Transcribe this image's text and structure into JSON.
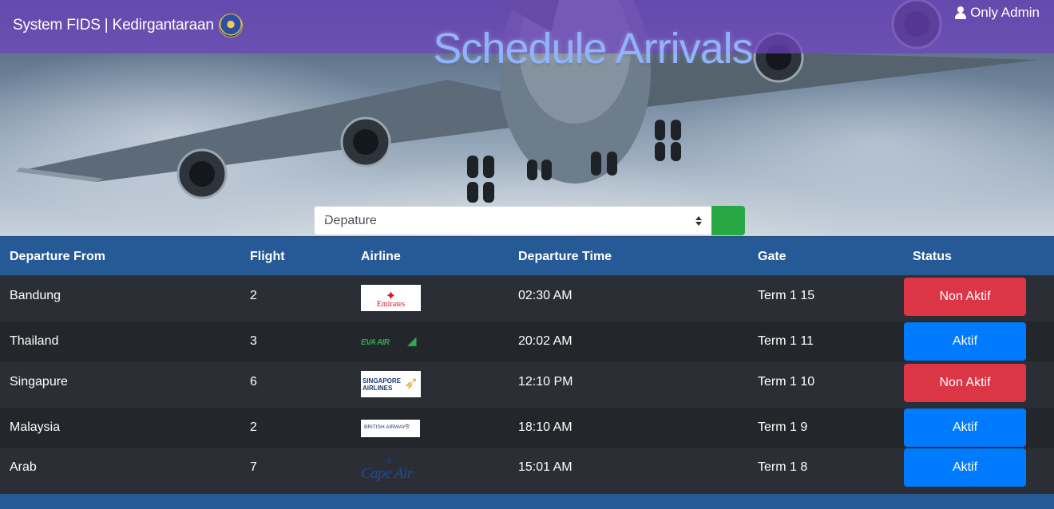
{
  "navbar": {
    "brand": "System FIDS | Kedirgantaraan",
    "admin_label": "Only Admin"
  },
  "hero": {
    "title": "Schedule Arrivals"
  },
  "search": {
    "selected": "Depature"
  },
  "table": {
    "headers": {
      "from": "Departure From",
      "flight": "Flight",
      "airline": "Airline",
      "time": "Departure Time",
      "gate": "Gate",
      "status": "Status"
    },
    "rows": [
      {
        "from": "Bandung",
        "flight": "2",
        "airline_logo": "Emirates",
        "time": "02:30 AM",
        "gate": "Term 1 15",
        "status": "Non Aktif"
      },
      {
        "from": "Thailand",
        "flight": "3",
        "airline_logo": "EVA AIR",
        "time": "20:02 AM",
        "gate": "Term 1 11",
        "status": "Aktif"
      },
      {
        "from": "Singapure",
        "flight": "6",
        "airline_logo": "SINGAPORE AIRLINES",
        "time": "12:10 PM",
        "gate": "Term 1 10",
        "status": "Non Aktif"
      },
      {
        "from": "Malaysia",
        "flight": "2",
        "airline_logo": "BRITISH AIRWAYS",
        "time": "18:10 AM",
        "gate": "Term 1 9",
        "status": "Aktif"
      },
      {
        "from": "Arab",
        "flight": "7",
        "airline_logo": "Cape Air",
        "time": "15:01 AM",
        "gate": "Term 1 8",
        "status": "Aktif"
      }
    ]
  },
  "colors": {
    "navbar": "#6f42c1",
    "table_header": "#265a97",
    "status_inactive": "#dc3545",
    "status_active": "#007bff",
    "search_button": "#28a745"
  }
}
